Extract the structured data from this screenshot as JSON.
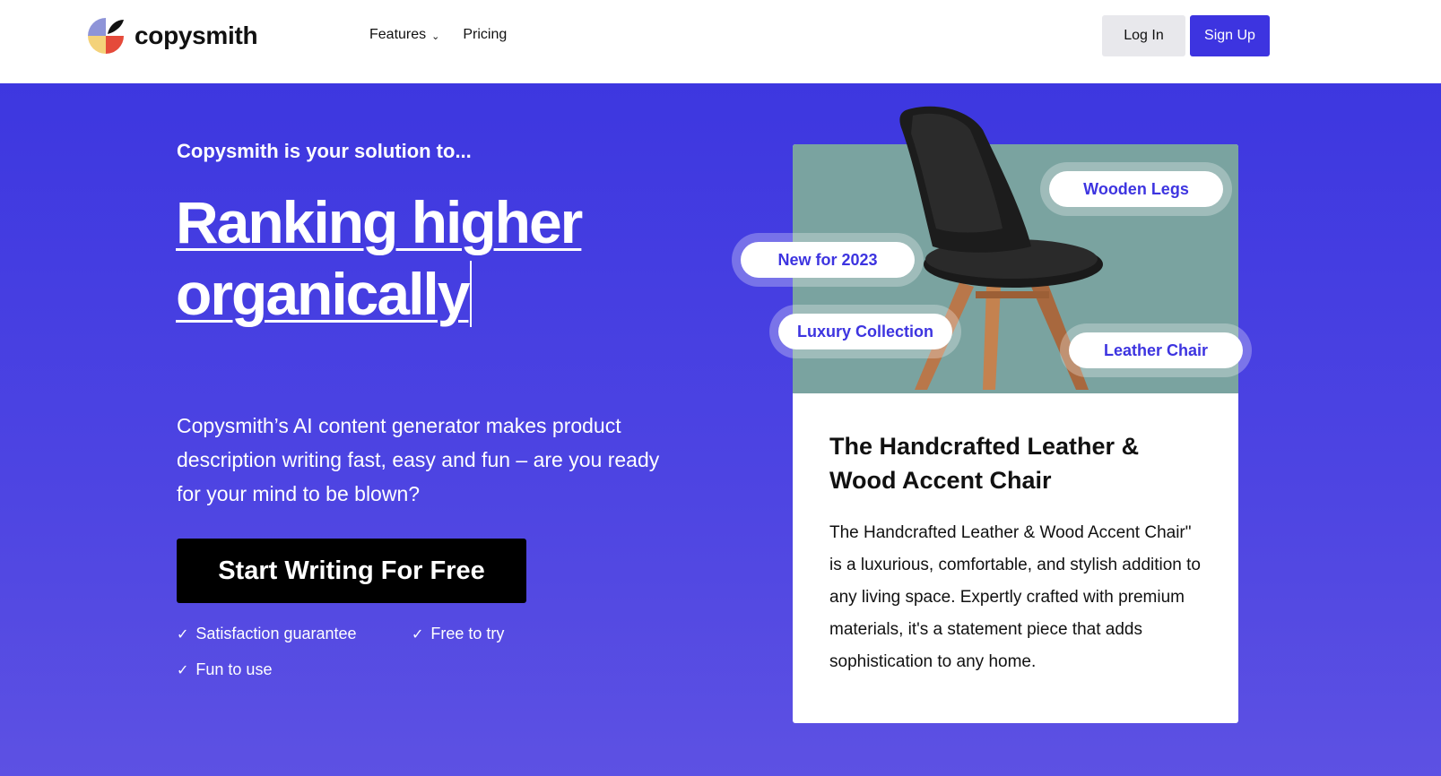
{
  "brand": {
    "name": "copysmith"
  },
  "nav": {
    "features": "Features",
    "pricing": "Pricing"
  },
  "auth": {
    "login": "Log In",
    "signup": "Sign Up"
  },
  "hero": {
    "eyebrow": "Copysmith is your solution to...",
    "headline_line1": "Ranking higher",
    "headline_line2": "organically",
    "description": "Copysmith’s AI content generator makes product description writing fast, easy and fun – are you ready for your mind to be blown?",
    "cta": "Start Writing For Free",
    "checks": [
      "Satisfaction guarantee",
      "Free to try",
      "Fun to use"
    ]
  },
  "product": {
    "tags": [
      "Wooden Legs",
      "New for 2023",
      "Luxury Collection",
      "Leather Chair"
    ],
    "title": "The Handcrafted Leather & Wood Accent Chair",
    "body": "The Handcrafted Leather & Wood Accent Chair\" is a luxurious, comfortable, and stylish addition to any living space. Expertly crafted with premium materials, it's a statement piece that adds sophistication to any home."
  },
  "colors": {
    "accent": "#3d34e0",
    "hero_bg": "#4a42e1",
    "image_bg": "#7aa3a0"
  }
}
